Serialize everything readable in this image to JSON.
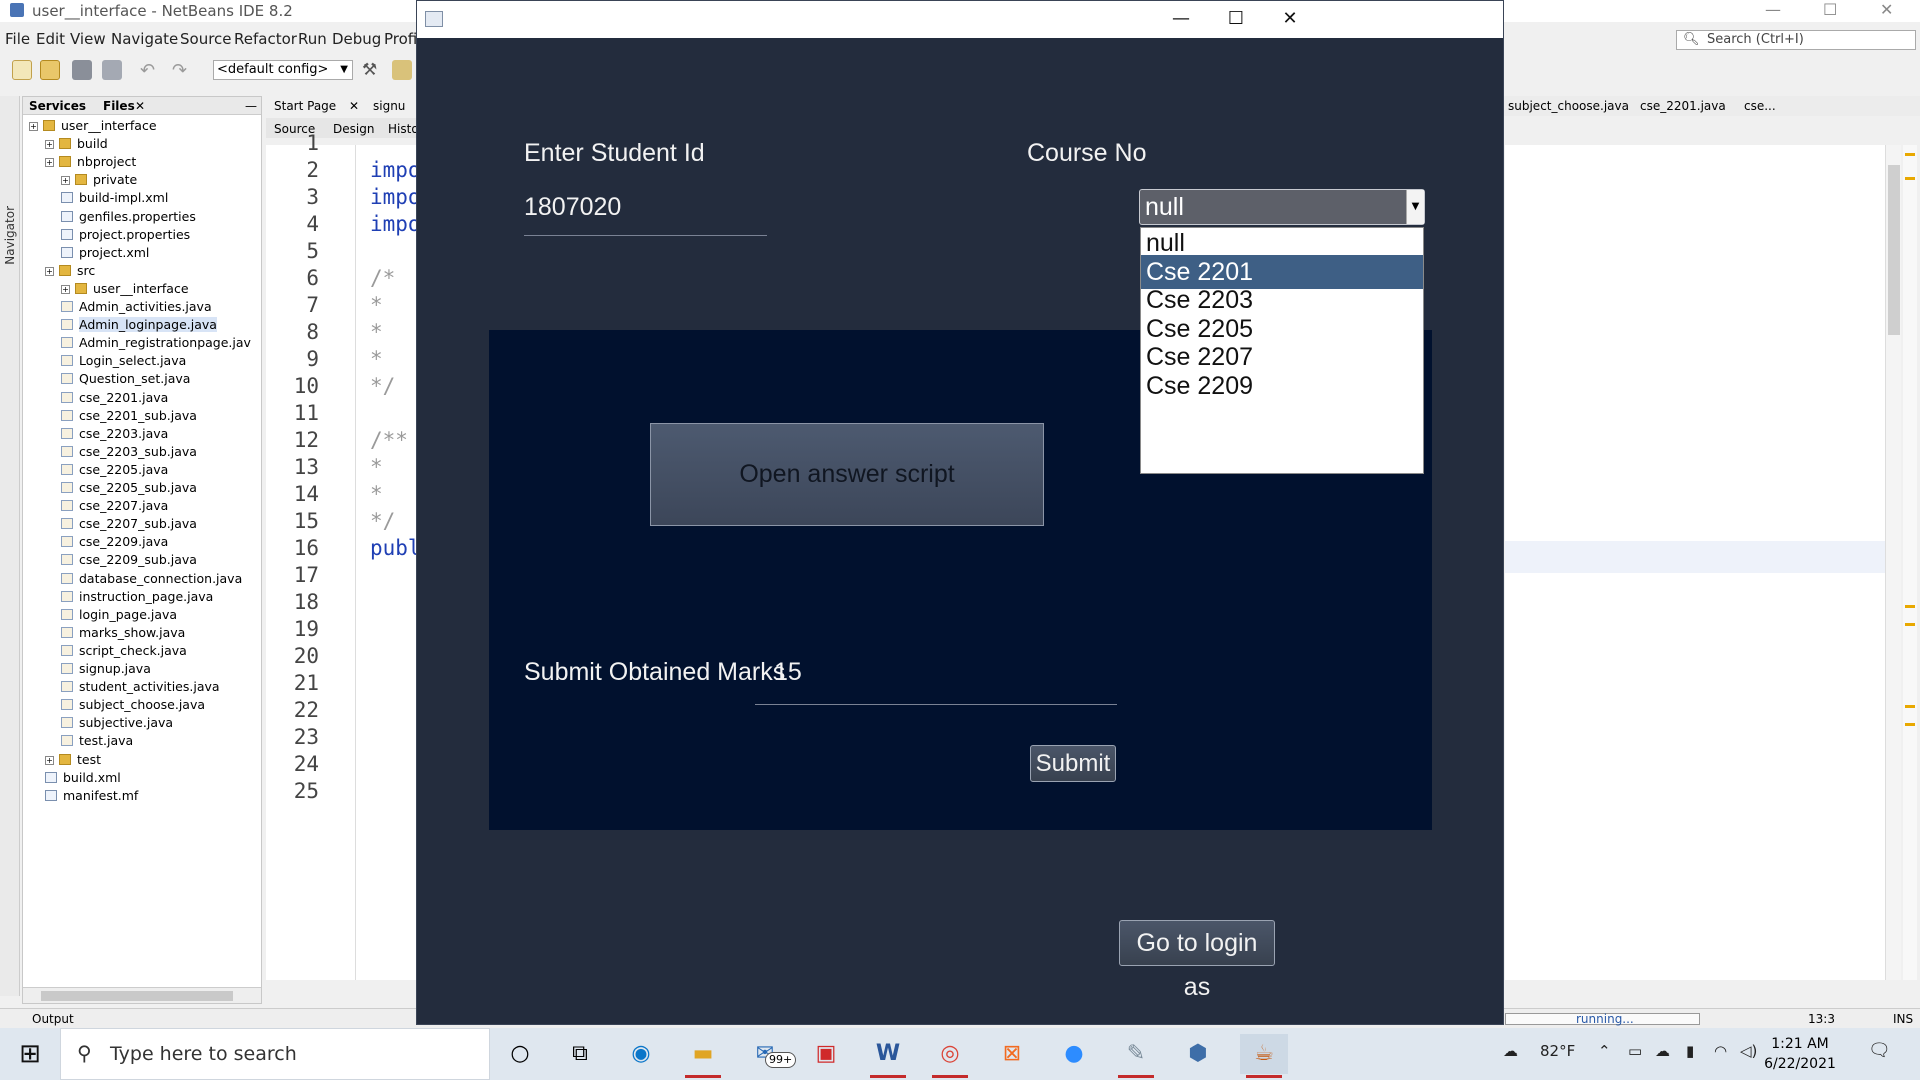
{
  "ide": {
    "title": "user__interface - NetBeans IDE 8.2",
    "menu": [
      "File",
      "Edit",
      "View",
      "Navigate",
      "Source",
      "Refactor",
      "Run",
      "Debug",
      "Profi"
    ],
    "config": "<default config>",
    "search_placeholder": "Search (Ctrl+I)",
    "navigator_label": "Navigator",
    "panel_tabs": [
      "Services",
      "Files"
    ],
    "tree": [
      {
        "label": "user__interface",
        "depth": 0,
        "kind": "root"
      },
      {
        "label": "build",
        "depth": 1,
        "kind": "folder"
      },
      {
        "label": "nbproject",
        "depth": 1,
        "kind": "folder"
      },
      {
        "label": "private",
        "depth": 2,
        "kind": "folder"
      },
      {
        "label": "build-impl.xml",
        "depth": 2,
        "kind": "file"
      },
      {
        "label": "genfiles.properties",
        "depth": 2,
        "kind": "file"
      },
      {
        "label": "project.properties",
        "depth": 2,
        "kind": "file"
      },
      {
        "label": "project.xml",
        "depth": 2,
        "kind": "file"
      },
      {
        "label": "src",
        "depth": 1,
        "kind": "folder"
      },
      {
        "label": "user__interface",
        "depth": 2,
        "kind": "folder"
      },
      {
        "label": "Admin_activities.java",
        "depth": 2,
        "kind": "java"
      },
      {
        "label": "Admin_loginpage.java",
        "depth": 2,
        "kind": "java",
        "selected": true
      },
      {
        "label": "Admin_registrationpage.jav",
        "depth": 2,
        "kind": "java"
      },
      {
        "label": "Login_select.java",
        "depth": 2,
        "kind": "java"
      },
      {
        "label": "Question_set.java",
        "depth": 2,
        "kind": "java"
      },
      {
        "label": "cse_2201.java",
        "depth": 2,
        "kind": "java"
      },
      {
        "label": "cse_2201_sub.java",
        "depth": 2,
        "kind": "java"
      },
      {
        "label": "cse_2203.java",
        "depth": 2,
        "kind": "java"
      },
      {
        "label": "cse_2203_sub.java",
        "depth": 2,
        "kind": "java"
      },
      {
        "label": "cse_2205.java",
        "depth": 2,
        "kind": "java"
      },
      {
        "label": "cse_2205_sub.java",
        "depth": 2,
        "kind": "java"
      },
      {
        "label": "cse_2207.java",
        "depth": 2,
        "kind": "java"
      },
      {
        "label": "cse_2207_sub.java",
        "depth": 2,
        "kind": "java"
      },
      {
        "label": "cse_2209.java",
        "depth": 2,
        "kind": "java"
      },
      {
        "label": "cse_2209_sub.java",
        "depth": 2,
        "kind": "java"
      },
      {
        "label": "database_connection.java",
        "depth": 2,
        "kind": "java"
      },
      {
        "label": "instruction_page.java",
        "depth": 2,
        "kind": "java"
      },
      {
        "label": "login_page.java",
        "depth": 2,
        "kind": "java"
      },
      {
        "label": "marks_show.java",
        "depth": 2,
        "kind": "java"
      },
      {
        "label": "script_check.java",
        "depth": 2,
        "kind": "java"
      },
      {
        "label": "signup.java",
        "depth": 2,
        "kind": "java"
      },
      {
        "label": "student_activities.java",
        "depth": 2,
        "kind": "java"
      },
      {
        "label": "subject_choose.java",
        "depth": 2,
        "kind": "java"
      },
      {
        "label": "subjective.java",
        "depth": 2,
        "kind": "java"
      },
      {
        "label": "test.java",
        "depth": 2,
        "kind": "java"
      },
      {
        "label": "test",
        "depth": 1,
        "kind": "folder"
      },
      {
        "label": "build.xml",
        "depth": 1,
        "kind": "file"
      },
      {
        "label": "manifest.mf",
        "depth": 1,
        "kind": "file"
      }
    ],
    "editor_tabs": [
      "Start Page",
      "signu"
    ],
    "editor_subtabs": [
      "Source",
      "Design",
      "Histo"
    ],
    "line_numbers": [
      "1",
      "2",
      "3",
      "4",
      "5",
      "6",
      "7",
      "8",
      "9",
      "10",
      "11",
      "12",
      "13",
      "14",
      "15",
      "16",
      "17",
      "18",
      "19",
      "20",
      "21",
      "22",
      "23",
      "24",
      "25"
    ],
    "code_fragments": [
      {
        "line": 2,
        "text": "impo"
      },
      {
        "line": 3,
        "text": "impo"
      },
      {
        "line": 4,
        "text": "impo"
      },
      {
        "line": 6,
        "text": "/*"
      },
      {
        "line": 7,
        "text": " *"
      },
      {
        "line": 8,
        "text": " *"
      },
      {
        "line": 9,
        "text": " *"
      },
      {
        "line": 10,
        "text": " */"
      },
      {
        "line": 12,
        "text": "/**"
      },
      {
        "line": 13,
        "text": " *"
      },
      {
        "line": 14,
        "text": " *"
      },
      {
        "line": 15,
        "text": " */"
      },
      {
        "line": 16,
        "text": "publ"
      }
    ],
    "right_tabs": [
      "subject_choose.java",
      "cse_2201.java",
      "cse..."
    ],
    "output_label": "Output",
    "status_running": "running...",
    "caret_pos": "13:3",
    "insert_mode": "INS"
  },
  "app": {
    "student_id_label": "Enter Student Id",
    "student_id_value": "1807020",
    "course_label": "Course No",
    "course_selected": "null",
    "course_options": [
      "null",
      "Cse 2201",
      "Cse 2203",
      "Cse 2205",
      "Cse 2207",
      "Cse 2209"
    ],
    "highlighted_option": 1,
    "open_script_label": "Open answer script",
    "marks_label": "Submit Obtained Marks",
    "marks_value": "15",
    "submit_label": "Submit",
    "go_login_label": "Go to login as"
  },
  "taskbar": {
    "search_placeholder": "Type here to search",
    "mail_badge": "99+",
    "temperature": "82°F",
    "time": "1:21 AM",
    "date": "6/22/2021"
  },
  "colors": {
    "window_bg": "#232c3d",
    "inner_panel": "#01112e",
    "dropdown_highlight": "#3e5f85"
  }
}
